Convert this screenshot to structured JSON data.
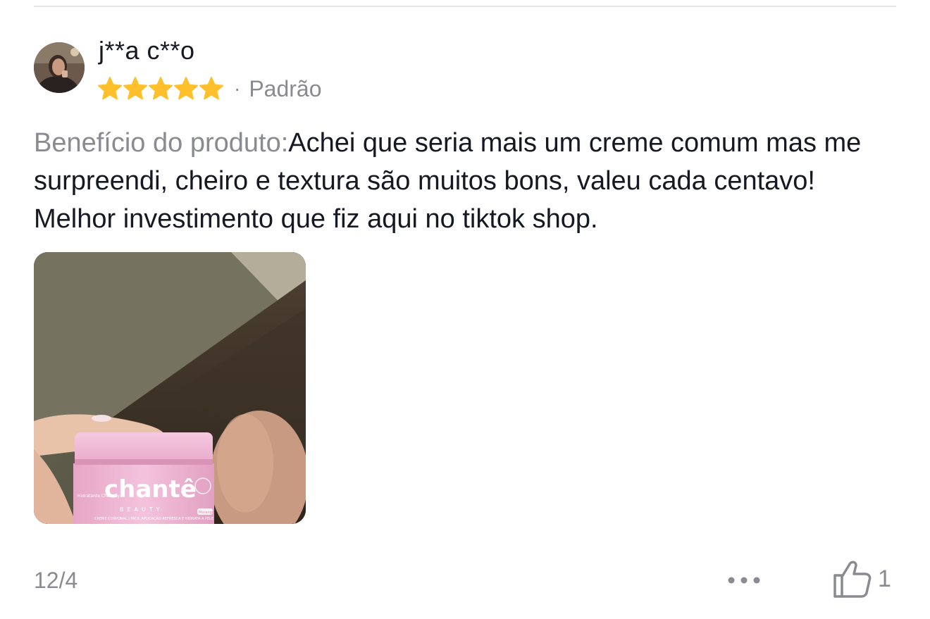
{
  "review": {
    "username": "j**a c**o",
    "rating": 5,
    "separator": "·",
    "variant": "Padrão",
    "text_label": "Benefício do produto:",
    "text_body": "Achei que seria mais um creme comum mas me surpreendi, cheiro e textura são muitos bons, valeu cada centavo! Melhor investimento que fiz aqui no tiktok shop.",
    "photo": {
      "brand": "chantê",
      "sub_brand": "BEAUTY",
      "side_text": "Hidratante Chantilly",
      "front_text": "CREME CORPORAL | FÁCIL APLICAÇÃO REFRESCA E HIDRATA A PELE",
      "tag_text": "Morango"
    },
    "date": "12/4",
    "likes": "1"
  },
  "icons": {
    "avatar": "user-avatar",
    "star": "star-icon",
    "more": "more-dots-icon",
    "like": "thumbs-up-icon"
  },
  "colors": {
    "star": "#FFC02B",
    "muted_text": "#8A8B91",
    "main_text": "#161823"
  }
}
